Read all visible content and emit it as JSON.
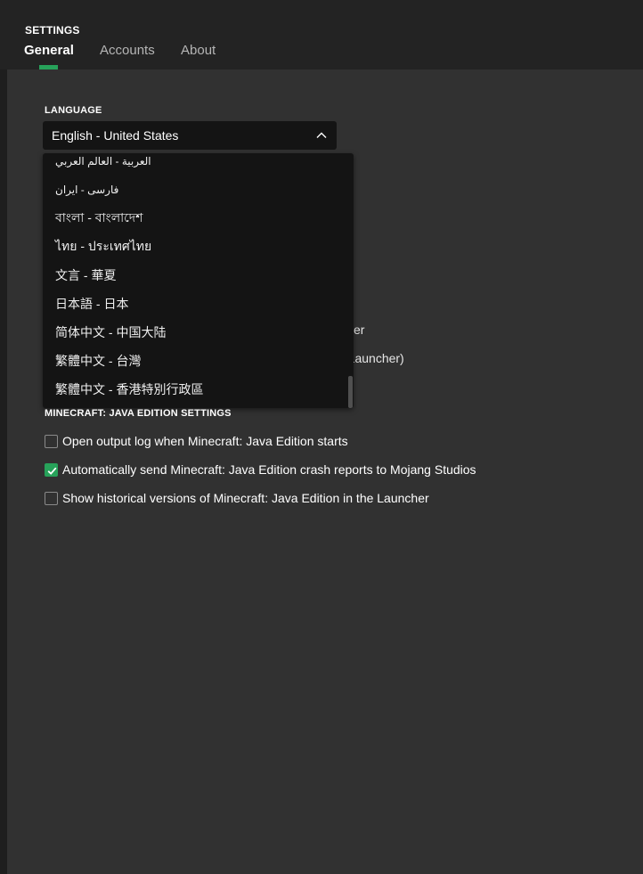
{
  "header": {
    "title": "SETTINGS",
    "tabs": [
      {
        "label": "General",
        "active": true
      },
      {
        "label": "Accounts",
        "active": false
      },
      {
        "label": "About",
        "active": false
      }
    ]
  },
  "language": {
    "section_label": "LANGUAGE",
    "selected": "English - United States",
    "options": [
      "العربية - العالم العربي",
      "فارسی - ایران",
      "বাংলা - বাংলাদেশ",
      "ไทย - ประเทศไทย",
      "文言 - 華夏",
      "日本語 - 日本",
      "简体中文 - 中国大陆",
      "繁體中文 - 台灣",
      "繁體中文 - 香港特別行政區"
    ]
  },
  "partially_hidden": {
    "line1_tail": "er",
    "line2_tail": "e Launcher)"
  },
  "java_settings": {
    "section_label": "MINECRAFT: JAVA EDITION SETTINGS",
    "options": [
      {
        "label": "Open output log when Minecraft: Java Edition starts",
        "checked": false
      },
      {
        "label": "Automatically send Minecraft: Java Edition crash reports to Mojang Studios",
        "checked": true
      },
      {
        "label": "Show historical versions of Minecraft: Java Edition in the Launcher",
        "checked": false
      }
    ]
  },
  "colors": {
    "accent": "#27a25a",
    "header_bg": "#232323",
    "content_bg": "#313131",
    "dropdown_bg": "#141414"
  }
}
